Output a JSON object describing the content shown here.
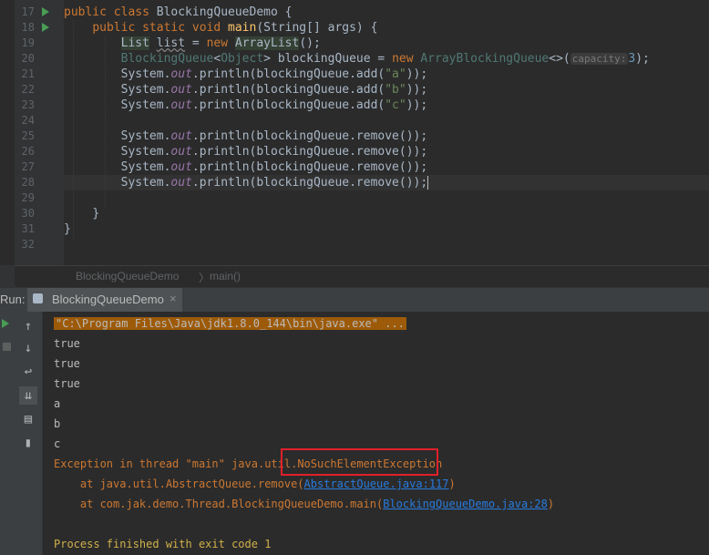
{
  "editor": {
    "line_numbers": [
      "17",
      "18",
      "19",
      "20",
      "21",
      "22",
      "23",
      "24",
      "25",
      "26",
      "27",
      "28",
      "29",
      "30",
      "31",
      "32"
    ],
    "lines": {
      "l17": {
        "kw1": "public class ",
        "cls": "BlockingQueueDemo",
        "tail": " {"
      },
      "l18": {
        "indent": "    ",
        "kw1": "public static void ",
        "mth": "main",
        "p1": "(",
        "cls": "String",
        "p2": "[] args) {"
      },
      "l19": {
        "indent": "        ",
        "t1": "List",
        "sp": " ",
        "t2": "list",
        "eq": " = ",
        "kw": "new ",
        "t3": "ArrayList",
        "tail": "();"
      },
      "l20": {
        "indent": "        ",
        "a": "BlockingQueue",
        "b": "<",
        "c": "Object",
        "d": ">",
        "e": " blockingQueue = ",
        "kw": "new ",
        "f": "ArrayBlockingQueue",
        "g": "<>(",
        "hint": "capacity:",
        "num": "3",
        "tail": ");"
      },
      "l21": {
        "indent": "        ",
        "a": "System.",
        "fld": "out",
        "b": ".println(blockingQueue.",
        "m": "add",
        "c": "(",
        "s": "\"a\"",
        "d": "));"
      },
      "l22": {
        "indent": "        ",
        "a": "System.",
        "fld": "out",
        "b": ".println(blockingQueue.",
        "m": "add",
        "c": "(",
        "s": "\"b\"",
        "d": "));"
      },
      "l23": {
        "indent": "        ",
        "a": "System.",
        "fld": "out",
        "b": ".println(blockingQueue.",
        "m": "add",
        "c": "(",
        "s": "\"c\"",
        "d": "));"
      },
      "l25": {
        "indent": "        ",
        "a": "System.",
        "fld": "out",
        "b": ".println(blockingQueue.",
        "m": "remove",
        "d": "());"
      },
      "l26": {
        "indent": "        ",
        "a": "System.",
        "fld": "out",
        "b": ".println(blockingQueue.",
        "m": "remove",
        "d": "());"
      },
      "l27": {
        "indent": "        ",
        "a": "System.",
        "fld": "out",
        "b": ".println(blockingQueue.",
        "m": "remove",
        "d": "());"
      },
      "l28": {
        "indent": "        ",
        "a": "System.",
        "fld": "out",
        "b": ".println(blockingQueue.",
        "m": "remove",
        "d": "());"
      },
      "l30": {
        "indent": "    ",
        "t": "}"
      },
      "l31": {
        "t": "}"
      }
    }
  },
  "breadcrumb": {
    "class": "BlockingQueueDemo",
    "sep": "〉",
    "method": "main()"
  },
  "run_panel": {
    "label": "Run:",
    "tab_title": "BlockingQueueDemo",
    "tab_close": "×"
  },
  "console": {
    "cmd": "\"C:\\Program Files\\Java\\jdk1.8.0_144\\bin\\java.exe\" ...",
    "outputs": [
      "true",
      "true",
      "true",
      "a",
      "b",
      "c"
    ],
    "exception_prefix": "Exception in thread \"main\" java.util.",
    "exception_name": "NoSuchElementException",
    "trace1_pre": "    at java.util.AbstractQueue.remove(",
    "trace1_link": "AbstractQueue.java:117",
    "trace1_post": ")",
    "trace2_pre": "    at com.jak.demo.Thread.BlockingQueueDemo.main(",
    "trace2_link": "BlockingQueueDemo.java:28",
    "trace2_post": ")",
    "finished": "Process finished with exit code 1"
  },
  "colors": {
    "keyword": "#cc7832",
    "string": "#6a8759",
    "error_box": "#e0202a",
    "link": "#287bde"
  }
}
